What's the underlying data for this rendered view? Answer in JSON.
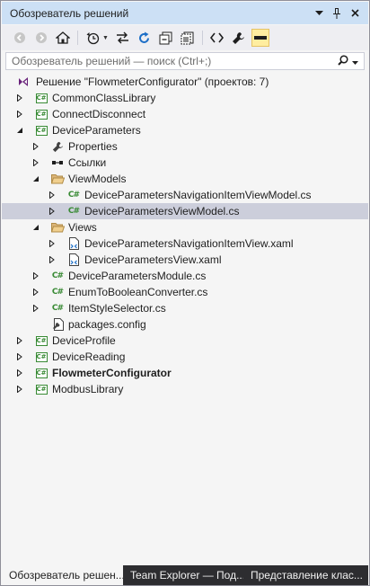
{
  "window": {
    "title": "Обозреватель решений",
    "title_icons": [
      "chevron-down-icon",
      "pin-icon",
      "close-icon"
    ]
  },
  "toolbar": {
    "icons": [
      "back-icon",
      "forward-icon",
      "home-icon",
      "history-icon",
      "sync-icon",
      "refresh-icon",
      "collapse-all-icon",
      "show-all-files-icon",
      "code-view-icon",
      "properties-icon",
      "preview-icon"
    ]
  },
  "search": {
    "placeholder": "Обозреватель решений — поиск (Ctrl+;)"
  },
  "tree": {
    "solution_label": "Решение \"FlowmeterConfigurator\"  (проектов: 7)",
    "items": [
      {
        "label": "CommonClassLibrary"
      },
      {
        "label": "ConnectDisconnect"
      },
      {
        "label": "DeviceParameters"
      },
      {
        "label": "Properties"
      },
      {
        "label": "Ссылки"
      },
      {
        "label": "ViewModels"
      },
      {
        "label": "DeviceParametersNavigationItemViewModel.cs"
      },
      {
        "label": "DeviceParametersViewModel.cs"
      },
      {
        "label": "Views"
      },
      {
        "label": "DeviceParametersNavigationItemView.xaml"
      },
      {
        "label": "DeviceParametersView.xaml"
      },
      {
        "label": "DeviceParametersModule.cs"
      },
      {
        "label": "EnumToBooleanConverter.cs"
      },
      {
        "label": "ItemStyleSelector.cs"
      },
      {
        "label": "packages.config"
      },
      {
        "label": "DeviceProfile"
      },
      {
        "label": "DeviceReading"
      },
      {
        "label": "FlowmeterConfigurator"
      },
      {
        "label": "ModbusLibrary"
      }
    ]
  },
  "tabs": [
    {
      "label": "Обозреватель решен..."
    },
    {
      "label": "Team Explorer — Под..."
    },
    {
      "label": "Представление клас..."
    }
  ],
  "colors": {
    "title_bg": "#cce0f5",
    "selected_row": "#cccedb",
    "csharp_green": "#388a34",
    "folder": "#dcb67a",
    "tab_strip": "#2d2d30"
  }
}
